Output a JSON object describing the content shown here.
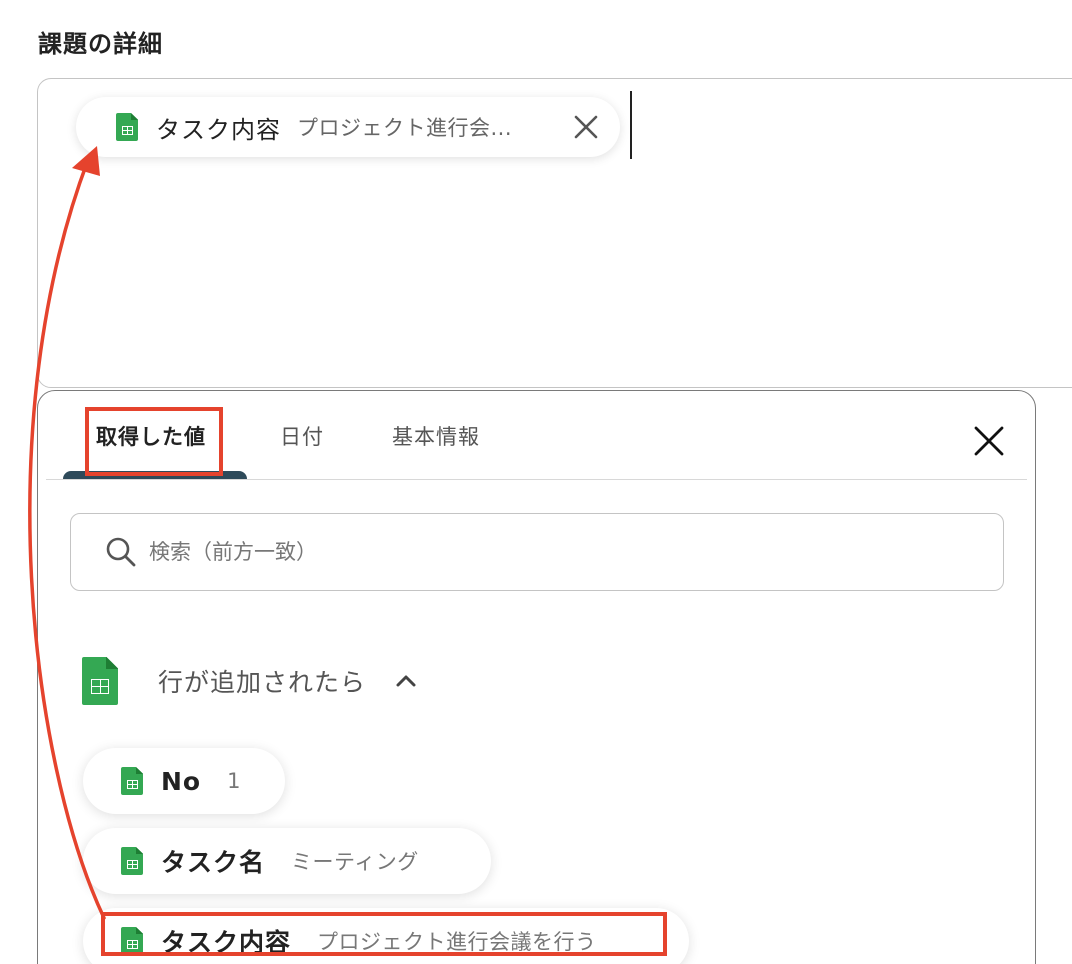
{
  "field": {
    "label": "課題の詳細"
  },
  "editor": {
    "chip": {
      "name": "タスク内容",
      "value": "プロジェクト進行会...",
      "icon": "google-sheets-icon"
    }
  },
  "panel": {
    "tabs": [
      {
        "label": "取得した値",
        "active": true
      },
      {
        "label": "日付",
        "active": false
      },
      {
        "label": "基本情報",
        "active": false
      }
    ],
    "search": {
      "placeholder": "検索（前方一致）"
    },
    "group": {
      "title": "行が追加されたら",
      "icon": "google-sheets-icon"
    },
    "items": [
      {
        "name": "No",
        "value": "1"
      },
      {
        "name": "タスク名",
        "value": "ミーティング"
      },
      {
        "name": "タスク内容",
        "value": "プロジェクト進行会議を行う"
      }
    ]
  },
  "colors": {
    "highlight": "#e5432d",
    "sheets_green": "#34a853",
    "tab_underline": "#2e4a5a"
  }
}
